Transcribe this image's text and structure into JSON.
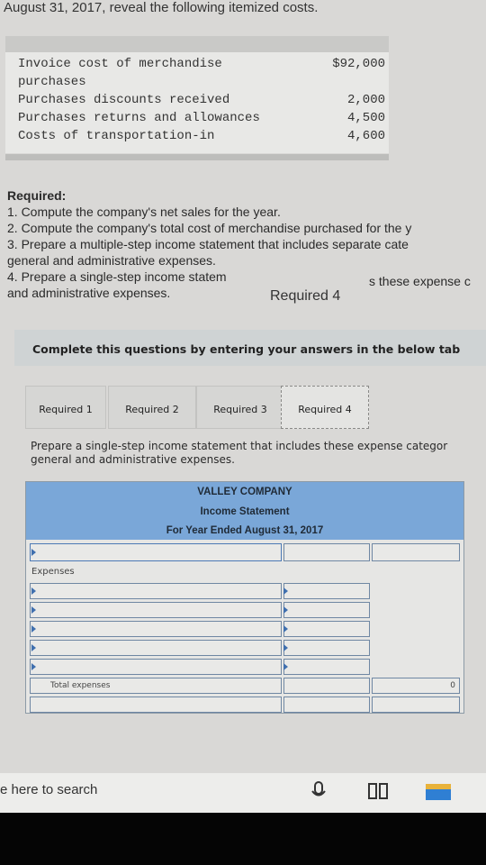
{
  "header_text": "August 31, 2017, reveal the following itemized costs.",
  "cost_items": [
    {
      "label": "Invoice cost of merchandise",
      "label2": "purchases",
      "value": "$92,000"
    },
    {
      "label": "Purchases discounts received",
      "value": "2,000"
    },
    {
      "label": "Purchases returns and allowances",
      "value": "4,500"
    },
    {
      "label": "Costs of transportation-in",
      "value": "4,600"
    }
  ],
  "required": {
    "heading": "Required:",
    "items": [
      "1. Compute the company's net sales for the year.",
      "2. Compute the company's total cost of merchandise purchased for the y",
      "3. Prepare a multiple-step income statement that includes separate cate",
      "general and administrative expenses.",
      "4. Prepare a single-step income statem",
      "and administrative expenses."
    ],
    "overlap_tail": "s these expense c",
    "popup_label": "Required 4"
  },
  "banner_text": "Complete this questions by entering your answers in the below tab",
  "tabs": [
    "Required 1",
    "Required 2",
    "Required 3",
    "Required 4"
  ],
  "instruction": {
    "line1": "Prepare a single-step income statement that includes these expense categor",
    "line2": "general and administrative expenses."
  },
  "statement": {
    "company": "VALLEY COMPANY",
    "title": "Income Statement",
    "period": "For Year Ended August 31, 2017",
    "expenses_label": "Expenses",
    "total_label": "Total expenses",
    "total_value": "0"
  },
  "taskbar": {
    "search_text": "e here to search"
  }
}
